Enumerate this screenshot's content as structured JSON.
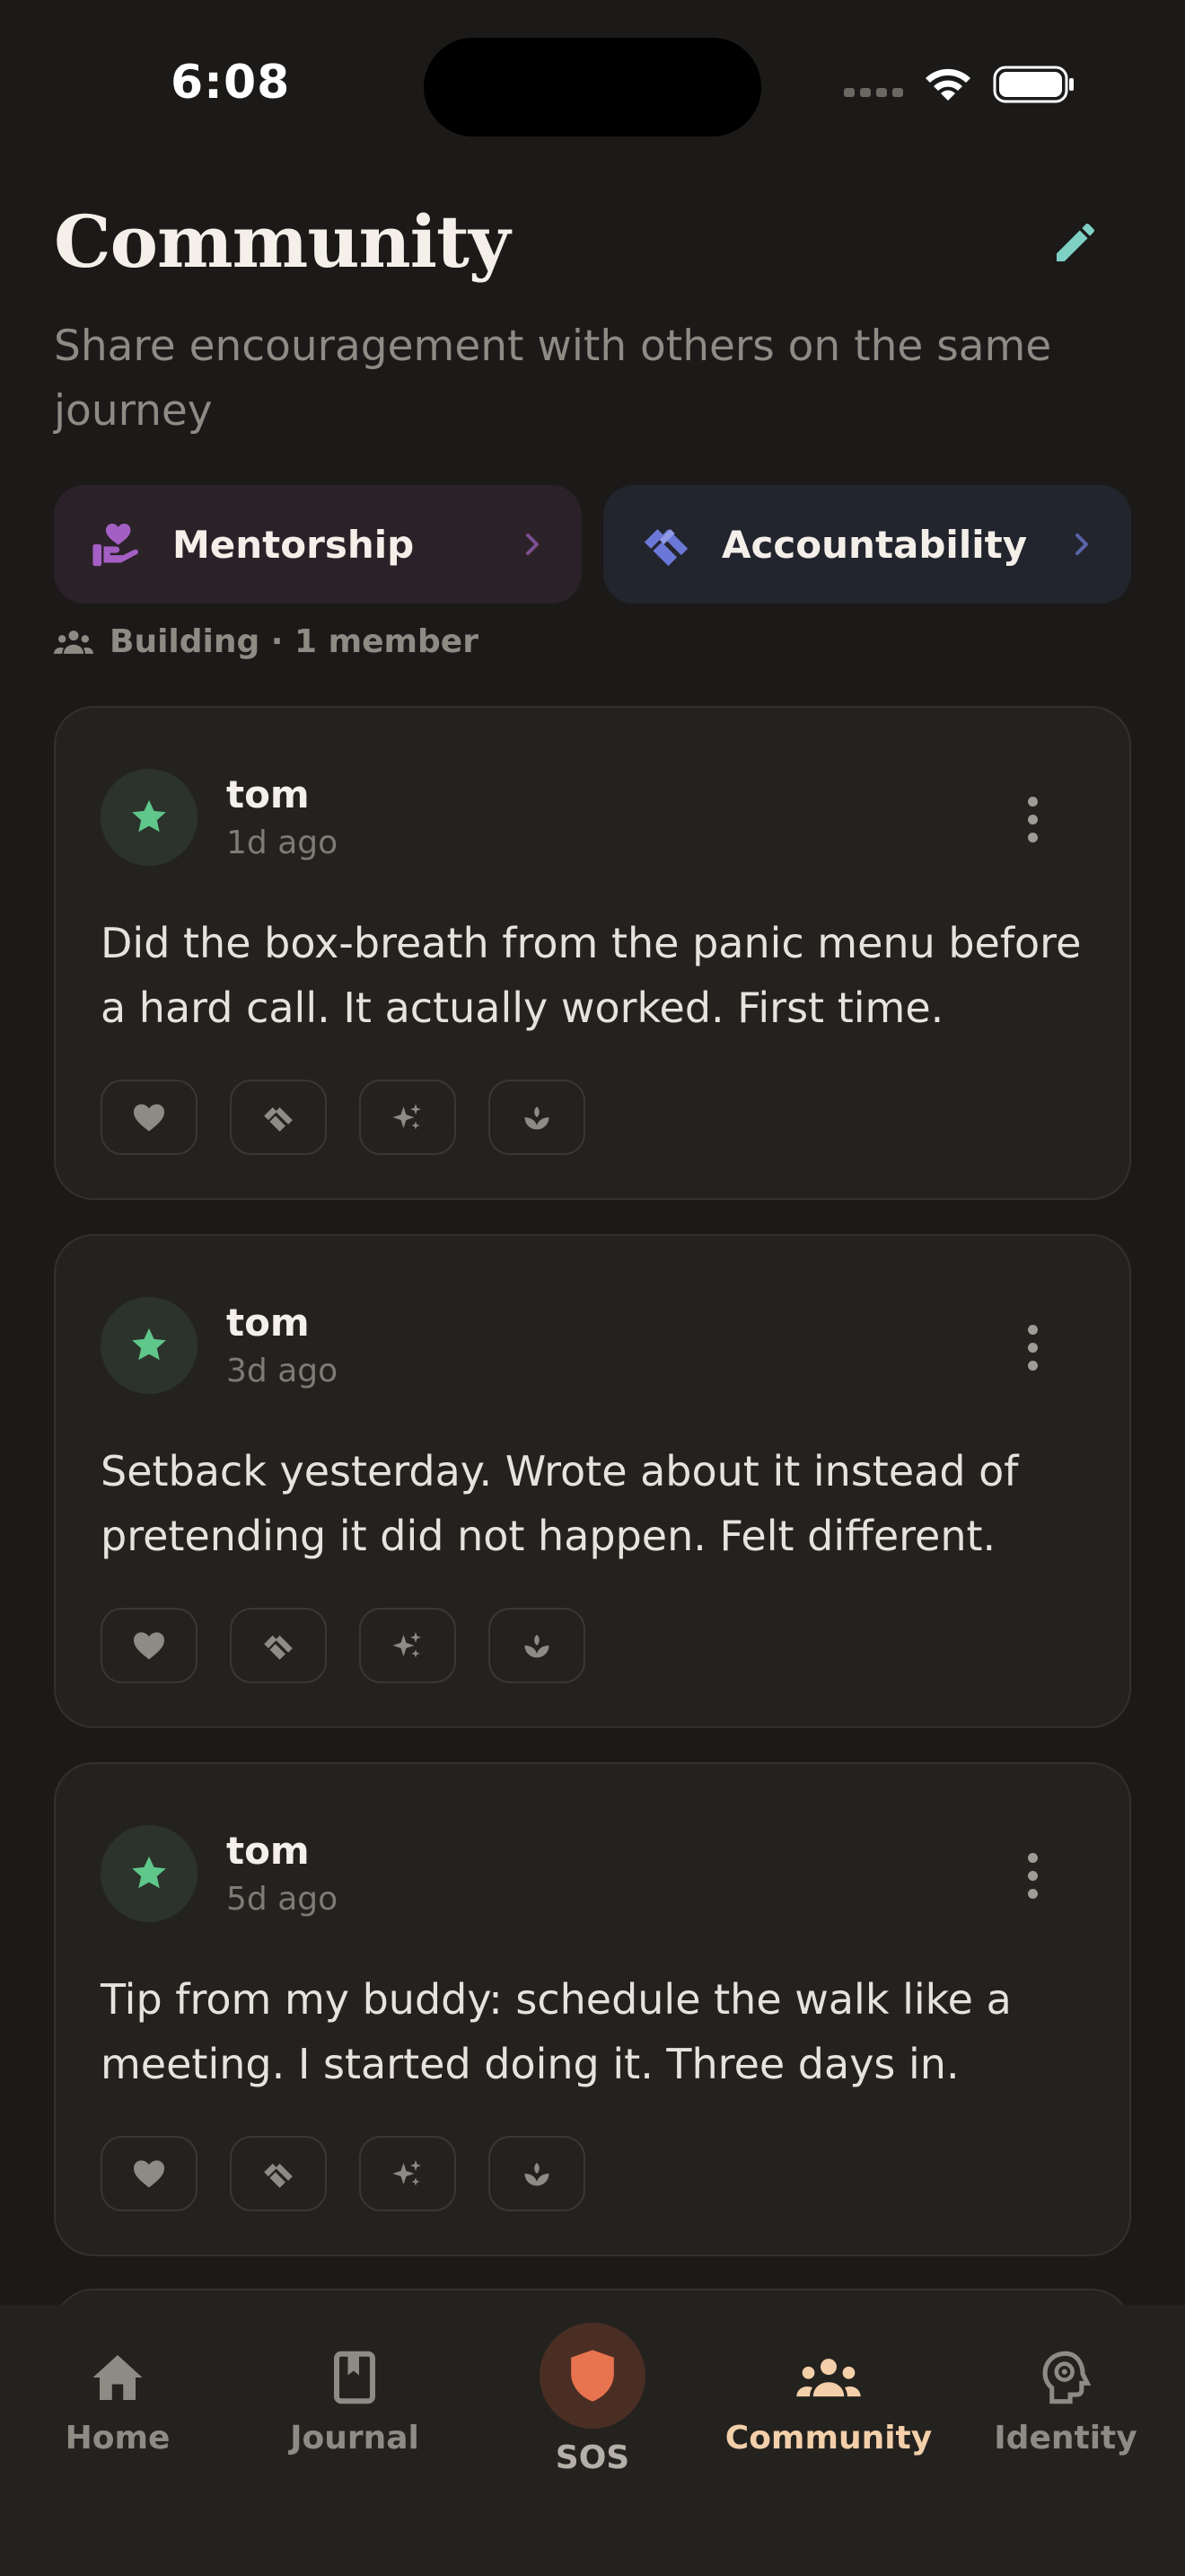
{
  "status_bar": {
    "time": "6:08"
  },
  "header": {
    "title": "Community",
    "subtitle": "Share encouragement with others on the same journey"
  },
  "tiles": [
    {
      "label": "Mentorship",
      "icon": "hand-heart-icon",
      "accent": "#a45fc4"
    },
    {
      "label": "Accountability",
      "icon": "handshake-icon",
      "accent": "#6b78d8"
    }
  ],
  "group": {
    "meta": "Building · 1 member"
  },
  "posts": [
    {
      "author": "tom",
      "time": "1d ago",
      "text": "Did the box-breath from the panic menu before a hard call. It actually worked. First time."
    },
    {
      "author": "tom",
      "time": "3d ago",
      "text": "Setback yesterday. Wrote about it instead of pretending it did not happen. Felt different."
    },
    {
      "author": "tom",
      "time": "5d ago",
      "text": "Tip from my buddy: schedule the walk like a meeting. I started doing it. Three days in."
    }
  ],
  "reactions": [
    "heart-icon",
    "handshake-icon",
    "sparkle-icon",
    "sprout-icon"
  ],
  "tabs": [
    {
      "label": "Home",
      "icon": "home-icon"
    },
    {
      "label": "Journal",
      "icon": "journal-icon"
    },
    {
      "label": "SOS",
      "icon": "shield-icon"
    },
    {
      "label": "Community",
      "icon": "people-icon"
    },
    {
      "label": "Identity",
      "icon": "head-gear-icon"
    }
  ],
  "colors": {
    "background": "#1b1a18",
    "card": "#24221f",
    "active_tab": "#f3cfaa",
    "sos": "#e8734f",
    "avatar_star": "#5fc78a",
    "edit_icon": "#7fd0c4"
  }
}
